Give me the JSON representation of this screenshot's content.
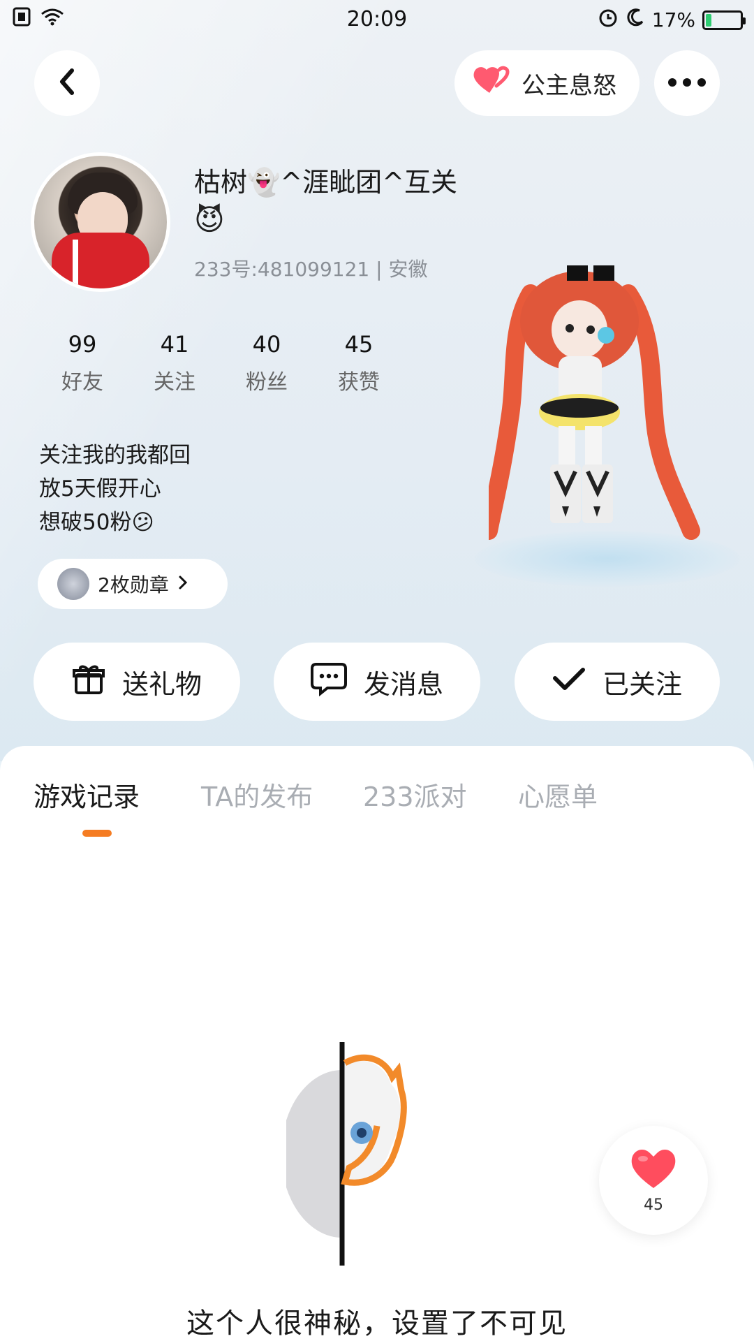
{
  "status_bar": {
    "time": "20:09",
    "battery": "17%",
    "battery_level": 0.17
  },
  "header": {
    "mood_label": "公主息怒"
  },
  "profile": {
    "username": "枯树👻^涯眦团^互关",
    "emoji": "😈",
    "uid_line": "233号:481099121 | 安徽",
    "stats": [
      {
        "num": "99",
        "label": "好友"
      },
      {
        "num": "41",
        "label": "关注"
      },
      {
        "num": "40",
        "label": "粉丝"
      },
      {
        "num": "45",
        "label": "获赞"
      }
    ],
    "bio": [
      "关注我的我都回",
      "放5天假开心",
      "想破50粉😕"
    ],
    "medal_label": "2枚勋章"
  },
  "actions": {
    "gift": "送礼物",
    "message": "发消息",
    "follow": "已关注"
  },
  "tabs": [
    "游戏记录",
    "TA的发布",
    "233派对",
    "心愿单"
  ],
  "empty_state": {
    "text": "这个人很神秘，设置了不可见"
  },
  "like": {
    "count": "45"
  },
  "colors": {
    "accent": "#f57c22",
    "heart": "#ff4d5e",
    "battery": "#2ecc71"
  }
}
